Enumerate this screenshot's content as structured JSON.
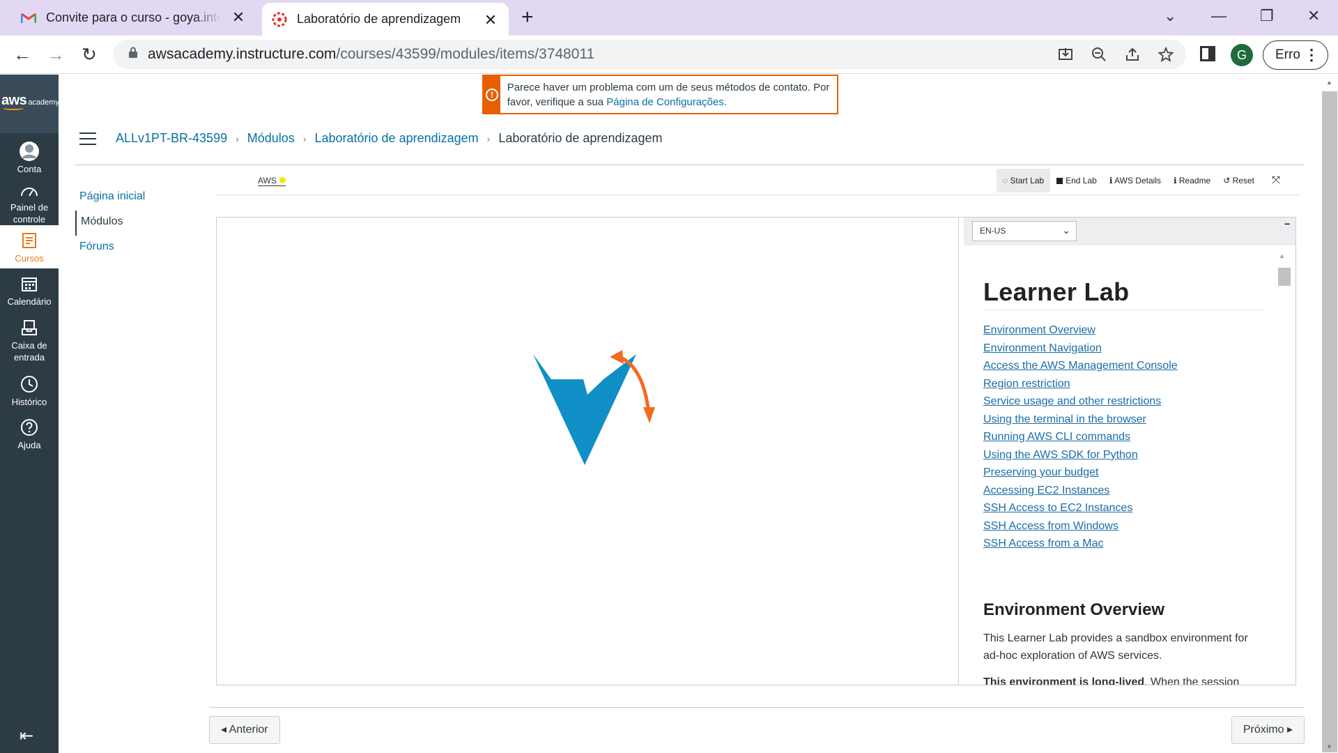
{
  "browser": {
    "tabs": [
      {
        "title": "Convite para o curso - goya.inteli",
        "icon": "gmail-icon"
      },
      {
        "title": "Laboratório de aprendizagem",
        "icon": "canvas-icon"
      }
    ],
    "url_host": "awsacademy.instructure.com",
    "url_path": "/courses/43599/modules/items/3748011",
    "profile_initial": "G",
    "error_label": "Erro"
  },
  "global_nav": {
    "logo_text": "aws",
    "logo_sub": "academy",
    "items": [
      {
        "label": "Conta",
        "icon": "user-icon"
      },
      {
        "label": "Painel de controle",
        "icon": "dashboard-icon"
      },
      {
        "label": "Cursos",
        "icon": "courses-icon"
      },
      {
        "label": "Calendário",
        "icon": "calendar-icon"
      },
      {
        "label": "Caixa de entrada",
        "icon": "inbox-icon"
      },
      {
        "label": "Histórico",
        "icon": "history-icon"
      },
      {
        "label": "Ajuda",
        "icon": "help-icon"
      }
    ]
  },
  "alert": {
    "text": "Parece haver um problema com um de seus métodos de contato. Por favor, verifique a sua ",
    "link": "Página de Configurações",
    "suffix": "."
  },
  "breadcrumbs": [
    "ALLv1PT-BR-43599",
    "Módulos",
    "Laboratório de aprendizagem",
    "Laboratório de aprendizagem"
  ],
  "course_nav": [
    "Página inicial",
    "Módulos",
    "Fóruns"
  ],
  "lab_toolbar": {
    "aws_label": "AWS",
    "status_color": "#f5e60c",
    "buttons": [
      "Start Lab",
      "End Lab",
      "AWS Details",
      "Readme",
      "Reset"
    ]
  },
  "readme": {
    "language": "EN-US",
    "title": "Learner Lab",
    "toc": [
      "Environment Overview",
      "Environment Navigation",
      "Access the AWS Management Console",
      "Region restriction",
      "Service usage and other restrictions",
      "Using the terminal in the browser",
      "Running AWS CLI commands",
      "Using the AWS SDK for Python",
      "Preserving your budget",
      "Accessing EC2 Instances",
      "SSH Access to EC2 Instances",
      "SSH Access from Windows",
      "SSH Access from a Mac"
    ],
    "section_title": "Environment Overview",
    "para1": "This Learner Lab provides a sandbox environment for ad-hoc exploration of AWS services.",
    "para2_bold": "This environment is long-lived",
    "para2_rest": ". When the session"
  },
  "pager": {
    "prev": "Anterior",
    "next": "Próximo"
  },
  "colors": {
    "accent": "#e77817",
    "nav_bg": "#2d3b45",
    "link": "#0770a3",
    "alert": "#e66000",
    "vocareum_blue": "#0f8fc6",
    "vocareum_orange": "#f26b22"
  }
}
